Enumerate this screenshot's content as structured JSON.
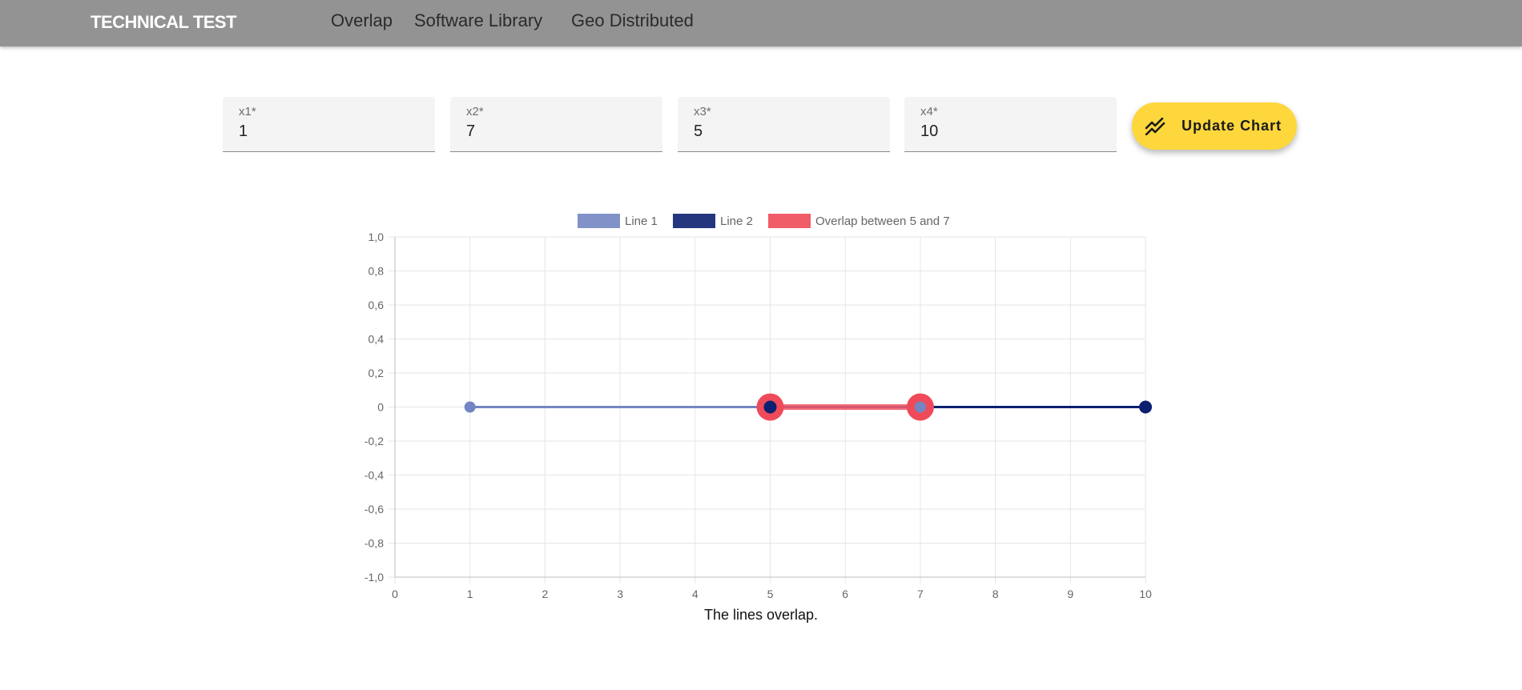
{
  "header": {
    "brand": "TECHNICAL TEST",
    "nav": [
      "Overlap",
      "Software Library",
      "Geo Distributed"
    ]
  },
  "form": {
    "fields": [
      {
        "label": "x1*",
        "value": "1"
      },
      {
        "label": "x2*",
        "value": "7"
      },
      {
        "label": "x3*",
        "value": "5"
      },
      {
        "label": "x4*",
        "value": "10"
      }
    ],
    "button": {
      "label": "Update Chart",
      "icon": "trending-chart-icon"
    }
  },
  "colors": {
    "header_bg": "#949393",
    "button": "#fdd73c",
    "line1": "#7386c3",
    "line2": "#0d2070",
    "overlap": "#ef4a59",
    "grid": "#e6e6e6"
  },
  "chart_data": {
    "type": "line",
    "series": [
      {
        "name": "Line 1",
        "points": [
          [
            1,
            0
          ],
          [
            7,
            0
          ]
        ],
        "color": "#7386c3"
      },
      {
        "name": "Line 2",
        "points": [
          [
            5,
            0
          ],
          [
            10,
            0
          ]
        ],
        "color": "#0d2070"
      },
      {
        "name": "Overlap between 5 and 7",
        "points": [
          [
            5,
            0
          ],
          [
            7,
            0
          ]
        ],
        "color": "#ef4a59"
      }
    ],
    "xlim": [
      0,
      10
    ],
    "ylim": [
      -1,
      1
    ],
    "xticks": [
      "0",
      "1",
      "2",
      "3",
      "4",
      "5",
      "6",
      "7",
      "8",
      "9",
      "10"
    ],
    "yticks": [
      "1,0",
      "0,8",
      "0,6",
      "0,4",
      "0,2",
      "0",
      "-0,2",
      "-0,4",
      "-0,6",
      "-0,8",
      "-1,0"
    ],
    "legend_position": "top",
    "grid": true
  },
  "result": "The lines overlap."
}
